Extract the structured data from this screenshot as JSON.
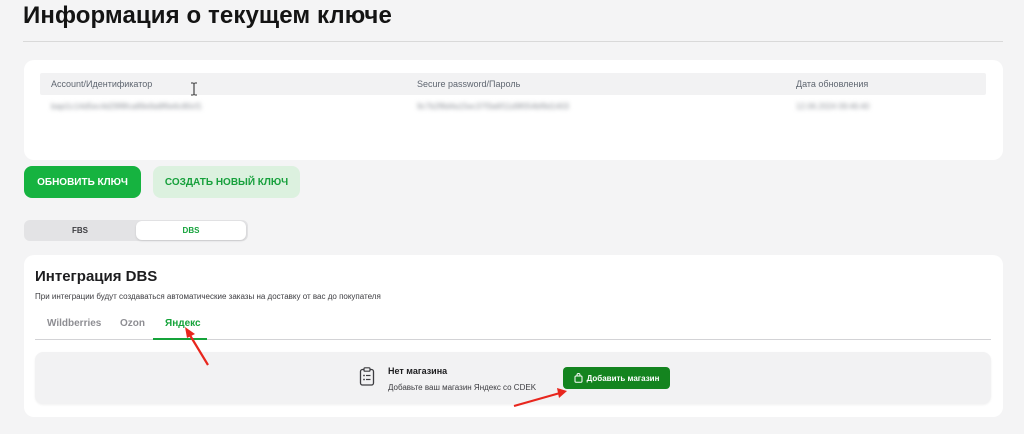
{
  "page": {
    "title": "Информация о текущем ключе"
  },
  "key_card": {
    "columns": [
      "Account/Идентификатор",
      "Secure password/Пароль",
      "Дата обновления"
    ],
    "row": {
      "account": "bapi1c14d5ec4d29f8fca89e9a8f6e6c80cf1",
      "password": "9c7b2f8d4a15ec37f3a6f11d9f054bf9d1403",
      "date": "12.06.2024 09:46:40"
    }
  },
  "buttons": {
    "refresh": "Обновить ключ",
    "create": "Создать новый ключ"
  },
  "segments": [
    "FBS",
    "DBS"
  ],
  "dbs": {
    "title": "Интеграция DBS",
    "subtitle": "При интеграции будут создаваться автоматические заказы на доставку от вас до покупателя",
    "tabs": [
      "Wildberries",
      "Ozon",
      "Яндекс"
    ],
    "active_tab": "Яндекс",
    "empty_state": {
      "title": "Нет магазина",
      "description": "Добавьте ваш магазин Яндекс со CDEK",
      "add_button": "Добавить магазин"
    }
  },
  "colors": {
    "accent": "#16b340",
    "annotation_arrow": "#e8261d"
  },
  "icons": [
    "text-cursor-icon",
    "clipboard-icon",
    "shopping-bag-icon",
    "red-arrow-annotation"
  ]
}
